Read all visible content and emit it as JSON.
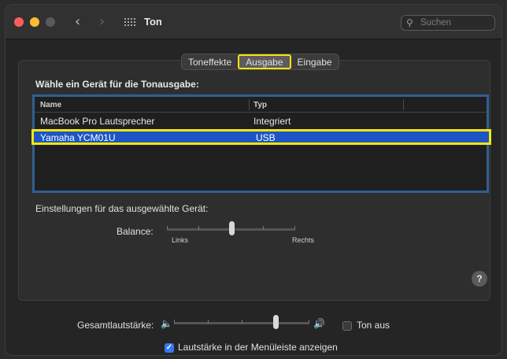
{
  "window": {
    "title": "Ton",
    "search_placeholder": "Suchen"
  },
  "tabs": [
    {
      "label": "Toneffekte"
    },
    {
      "label": "Ausgabe",
      "selected": true
    },
    {
      "label": "Eingabe"
    }
  ],
  "output": {
    "section_title": "Wähle ein Gerät für die Tonausgabe:",
    "columns": [
      "Name",
      "Typ"
    ],
    "devices": [
      {
        "name": "MacBook Pro Lautsprecher",
        "type": "Integriert",
        "selected": false
      },
      {
        "name": "Yamaha YCM01U",
        "type": "USB",
        "selected": true
      }
    ],
    "settings_label": "Einstellungen für das ausgewählte Gerät:",
    "balance": {
      "label": "Balance:",
      "left_label": "Links",
      "right_label": "Rechts",
      "value": 0.5
    }
  },
  "volume": {
    "label": "Gesamtlautstärke:",
    "value": 0.75,
    "mute_label": "Ton aus",
    "mute_checked": false
  },
  "menubar": {
    "label": "Lautstärke in der Menüleiste anzeigen",
    "checked": true
  },
  "help": "?",
  "icons": {
    "back": "chevron-left-icon",
    "forward": "chevron-right-icon",
    "grid": "grid-icon",
    "search": "magnifier-icon",
    "speaker_low": "speaker-low-icon",
    "speaker_high": "speaker-high-icon"
  },
  "colors": {
    "accent": "#3478f6",
    "selection": "#1d56c4",
    "highlight": "#f3e60f"
  }
}
